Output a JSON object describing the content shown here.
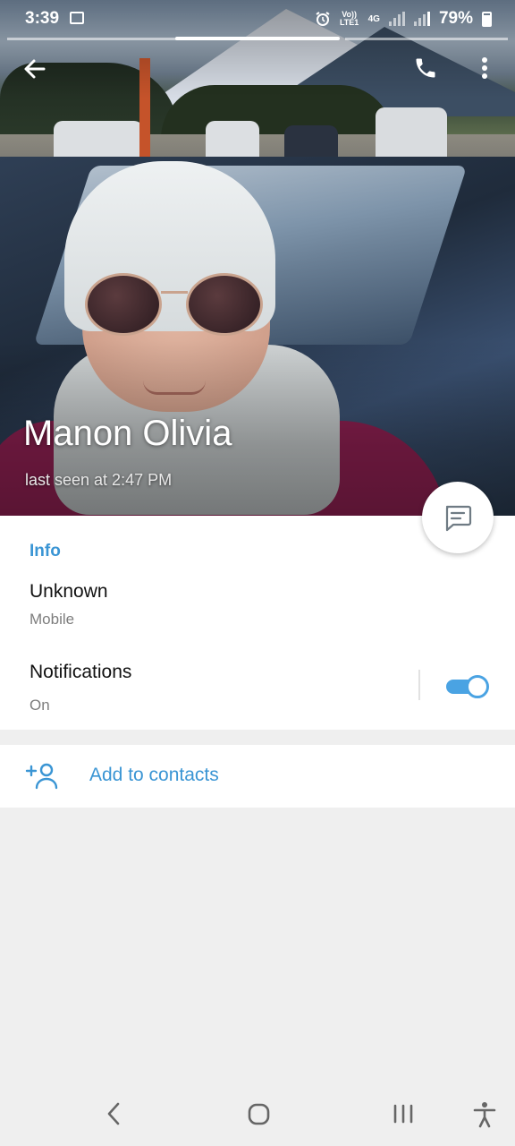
{
  "status_bar": {
    "time": "3:39",
    "volte": "Vo)) LTE1",
    "network": "4G",
    "battery": "79%"
  },
  "profile": {
    "name": "Manon Olivia",
    "last_seen": "last seen at 2:47 PM"
  },
  "info": {
    "section_title": "Info",
    "phone_value": "Unknown",
    "phone_type": "Mobile",
    "notifications_label": "Notifications",
    "notifications_state": "On",
    "notifications_enabled": true
  },
  "actions": {
    "add_to_contacts": "Add to contacts"
  },
  "colors": {
    "accent": "#3a95d4",
    "toggle_on": "#4aa3e3"
  },
  "icons": [
    "back-arrow-icon",
    "phone-icon",
    "more-vert-icon",
    "message-icon",
    "add-person-icon",
    "nav-back-icon",
    "nav-home-icon",
    "nav-recents-icon",
    "accessibility-icon"
  ]
}
